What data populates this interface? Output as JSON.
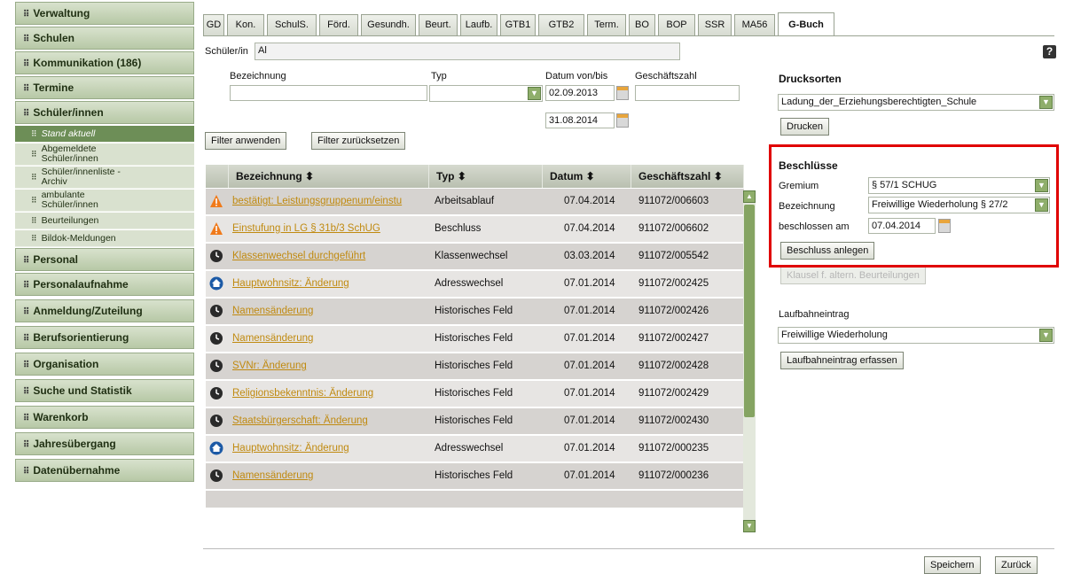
{
  "sidebar": {
    "items": [
      {
        "label": "Verwaltung"
      },
      {
        "label": "Schulen"
      },
      {
        "label": "Kommunikation (186)"
      },
      {
        "label": "Termine"
      },
      {
        "label": "Schüler/innen"
      }
    ],
    "subitems": [
      {
        "label": "Stand aktuell"
      },
      {
        "label": "Abgemeldete Schüler/innen"
      },
      {
        "label": "Schüler/innenliste - Archiv"
      },
      {
        "label": "ambulante Schüler/innen"
      },
      {
        "label": "Beurteilungen"
      },
      {
        "label": "Bildok-Meldungen"
      }
    ],
    "items_bottom": [
      {
        "label": "Personal"
      },
      {
        "label": "Personalaufnahme"
      },
      {
        "label": "Anmeldung/Zuteilung"
      },
      {
        "label": "Berufsorientierung"
      },
      {
        "label": "Organisation"
      },
      {
        "label": "Suche und Statistik"
      },
      {
        "label": "Warenkorb"
      },
      {
        "label": "Jahresübergang"
      },
      {
        "label": "Datenübernahme"
      }
    ]
  },
  "tabs": [
    "GD",
    "Kon.",
    "SchulS.",
    "Förd.",
    "Gesundh.",
    "Beurt.",
    "Laufb.",
    "GTB1",
    "GTB2",
    "Term.",
    "BO",
    "BOP",
    "SSR",
    "MA56",
    "G-Buch"
  ],
  "active_tab": "G-Buch",
  "student": {
    "label": "Schüler/in",
    "value": "Al"
  },
  "filter": {
    "bezeichnung_label": "Bezeichnung",
    "typ_label": "Typ",
    "datum_label": "Datum von/bis",
    "geschaeftszahl_label": "Geschäftszahl",
    "date_from": "02.09.2013",
    "date_to": "31.08.2014",
    "apply_button": "Filter anwenden",
    "reset_button": "Filter zurücksetzen"
  },
  "table": {
    "headers": [
      "Bezeichnung ⬍",
      "Typ ⬍",
      "Datum ⬍",
      "Geschäftszahl ⬍"
    ],
    "rows": [
      {
        "icon": "warning-icon",
        "bezeichnung": "bestätigt: Leistungsgruppenum/einstu",
        "typ": "Arbeitsablauf",
        "datum": "07.04.2014",
        "zahl": "911072/006603"
      },
      {
        "icon": "warning-icon",
        "bezeichnung": "Einstufung in LG § 31b/3 SchUG",
        "typ": "Beschluss",
        "datum": "07.04.2014",
        "zahl": "911072/006602"
      },
      {
        "icon": "clock-icon",
        "bezeichnung": "Klassenwechsel durchgeführt",
        "typ": "Klassenwechsel",
        "datum": "03.03.2014",
        "zahl": "911072/005542"
      },
      {
        "icon": "home-icon",
        "bezeichnung": "Hauptwohnsitz: Änderung",
        "typ": "Adresswechsel",
        "datum": "07.01.2014",
        "zahl": "911072/002425"
      },
      {
        "icon": "clock-icon",
        "bezeichnung": "Namensänderung",
        "typ": "Historisches Feld",
        "datum": "07.01.2014",
        "zahl": "911072/002426"
      },
      {
        "icon": "clock-icon",
        "bezeichnung": "Namensänderung",
        "typ": "Historisches Feld",
        "datum": "07.01.2014",
        "zahl": "911072/002427"
      },
      {
        "icon": "clock-icon",
        "bezeichnung": "SVNr: Änderung",
        "typ": "Historisches Feld",
        "datum": "07.01.2014",
        "zahl": "911072/002428"
      },
      {
        "icon": "clock-icon",
        "bezeichnung": "Religionsbekenntnis: Änderung",
        "typ": "Historisches Feld",
        "datum": "07.01.2014",
        "zahl": "911072/002429"
      },
      {
        "icon": "clock-icon",
        "bezeichnung": "Staatsbürgerschaft: Änderung",
        "typ": "Historisches Feld",
        "datum": "07.01.2014",
        "zahl": "911072/002430"
      },
      {
        "icon": "home-icon",
        "bezeichnung": "Hauptwohnsitz: Änderung",
        "typ": "Adresswechsel",
        "datum": "07.01.2014",
        "zahl": "911072/000235"
      },
      {
        "icon": "clock-icon",
        "bezeichnung": "Namensänderung",
        "typ": "Historisches Feld",
        "datum": "07.01.2014",
        "zahl": "911072/000236"
      }
    ]
  },
  "drucksorten": {
    "title": "Drucksorten",
    "selected": "Ladung_der_Erziehungsberechtigten_Schule",
    "print_button": "Drucken"
  },
  "beschluesse": {
    "title": "Beschlüsse",
    "gremium_label": "Gremium",
    "gremium_value": "§ 57/1 SCHUG",
    "bezeichnung_label": "Bezeichnung",
    "bezeichnung_value": "Freiwillige Wiederholung § 27/2",
    "date_label": "beschlossen am",
    "date_value": "07.04.2014",
    "create_button": "Beschluss anlegen",
    "klausel_button": "Klausel f. altern. Beurteilungen"
  },
  "laufbahn": {
    "label": "Laufbahneintrag",
    "selected": "Freiwillige Wiederholung",
    "button": "Laufbahneintrag erfassen"
  },
  "footer": {
    "save": "Speichern",
    "back": "Zurück"
  },
  "colors": {
    "highlight": "#e00000",
    "link": "#c08a10",
    "nav": "#b7c8a6"
  }
}
